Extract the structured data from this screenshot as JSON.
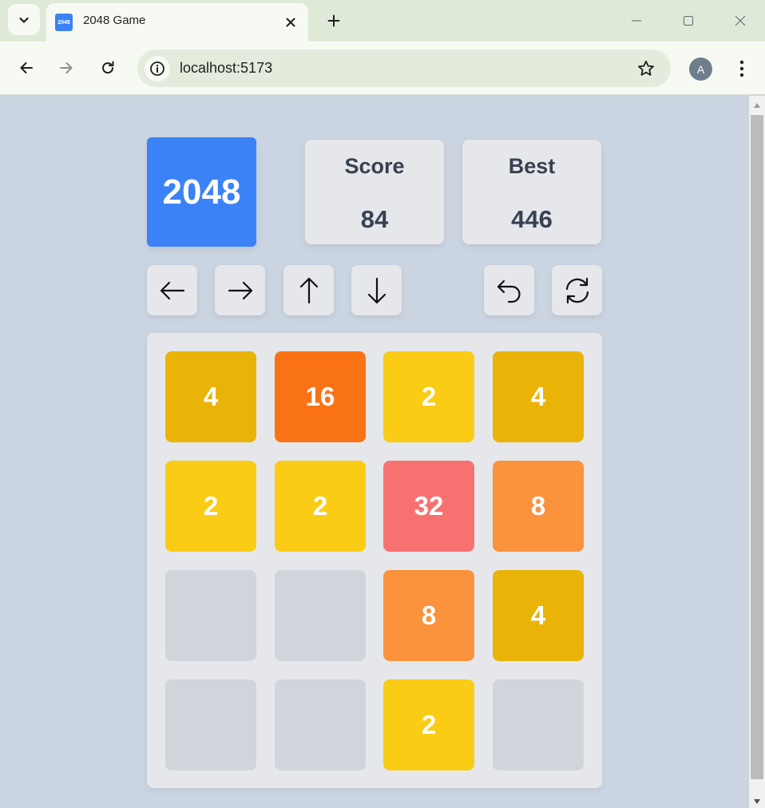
{
  "browser": {
    "tab_title": "2048 Game",
    "favicon_text": "2048",
    "url": "localhost:5173",
    "avatar_letter": "A"
  },
  "game": {
    "title": "2048",
    "score": {
      "label": "Score",
      "value": "84"
    },
    "best": {
      "label": "Best",
      "value": "446"
    },
    "board": [
      [
        "4",
        "16",
        "2",
        "4"
      ],
      [
        "2",
        "2",
        "32",
        "8"
      ],
      [
        "",
        "",
        "8",
        "4"
      ],
      [
        "",
        "",
        "2",
        ""
      ]
    ]
  },
  "tile_colors": {
    "2": "#facc15",
    "4": "#eab308",
    "8": "#fb923c",
    "16": "#f97316",
    "32": "#f87171",
    "empty": "#d1d5db"
  },
  "icons": {
    "controls": [
      "arrow-left-icon",
      "arrow-right-icon",
      "arrow-up-icon",
      "arrow-down-icon",
      "undo-icon",
      "restart-icon"
    ]
  }
}
